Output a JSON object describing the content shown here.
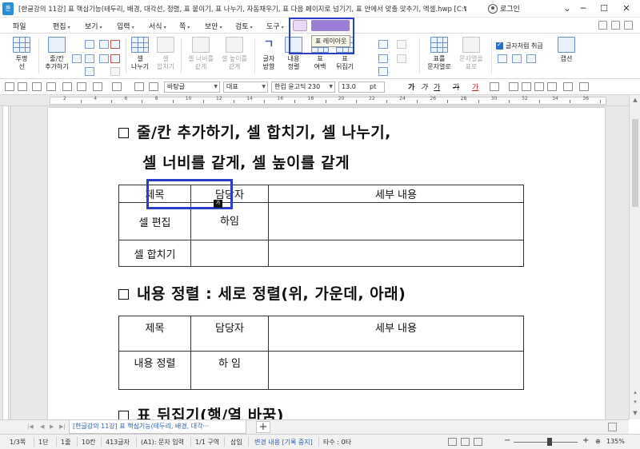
{
  "window": {
    "logo": "훈",
    "title": "[한글강의 11강] 표 핵심기능(테두리, 배경, 대각선, 정렬, 표 붙이기, 표 나누기, 자동채우기, 표 다음 페이지로 넘기기, 표 안에서 맞출 맞추기, 엑셀.hwp [C:₩Users₩user···",
    "login_label": "로그인",
    "minimize": "─",
    "maximize": "☐",
    "close": "✕"
  },
  "menubar": {
    "items": [
      "파일",
      "편집",
      "보기",
      "입력",
      "서식",
      "쪽",
      "보안",
      "검토",
      "도구"
    ],
    "tooltip": "표 레이아웃",
    "search_placeholder": "찾을 내용"
  },
  "ribbon": {
    "transparent_line": "투명\n선",
    "add_row_col": "줄/칸\n추가하기",
    "merge_cells": "셀\n나누기",
    "merge_cells_dis": "셀\n합치기",
    "equal_width": "셀 너비를\n같게",
    "equal_height": "셀 높이를\n같게",
    "text_direction": "글자\n방향",
    "content_align": "내용\n정렬",
    "table_margin": "표\n여백",
    "table_flip": "표\n뒤집기",
    "table_to_text": "표를\n문자열로",
    "text_to_table": "문자열을\n표로",
    "keep_text_check": "글자처럼 취급",
    "caption": "캡션"
  },
  "formatbar": {
    "style": "바탕글",
    "lang": "대표",
    "font": "한컴 윤고딕 230",
    "size": "13.0",
    "unit": "pt",
    "bold": "가",
    "italic": "가",
    "underline": "가",
    "strike": "가",
    "color": "가"
  },
  "ruler": {
    "numbers": [
      "2",
      "4",
      "6",
      "8",
      "10",
      "12",
      "14",
      "16",
      "18",
      "20",
      "22",
      "24",
      "26",
      "28",
      "30",
      "32",
      "34",
      "36"
    ]
  },
  "document": {
    "heading1_line1": "줄/칸 추가하기, 셀 합치기, 셀 나누기,",
    "heading1_line2": "셀 너비를 같게, 셀 높이를 같게",
    "table1": {
      "header": [
        "제목",
        "담당자",
        "세부 내용"
      ],
      "rows": [
        [
          "셀 편집",
          "하임",
          ""
        ],
        [
          "셀 합치기",
          "",
          ""
        ]
      ]
    },
    "cell_marker": "가",
    "heading2": "내용 정렬 : 세로 정렬(위, 가운데, 아래)",
    "table2": {
      "header": [
        "제목",
        "담당자",
        "세부 내용"
      ],
      "rows": [
        [
          "내용 정렬",
          "하 임",
          ""
        ]
      ]
    },
    "heading3": "표 뒤집기(행/열 바꿈)"
  },
  "tabbar": {
    "doc_tab": "[한글강의 11강] 표 핵심기능(테두리, 배경, 대각···",
    "add_tab": "+"
  },
  "statusbar": {
    "page": "1/3쪽",
    "section": "1단",
    "line": "1줄",
    "col": "10칸",
    "chars": "413글자",
    "mode": "(A1): 문자 입력",
    "area": "1/1 구역",
    "insert": "삽입",
    "track": "변경 내용 [기록 중지]",
    "typo": "타수 : 0타",
    "zoom": "135%",
    "zoom_minus": "−",
    "zoom_plus": "+"
  },
  "colors": {
    "highlight": "#2b3ec9",
    "tab_text": "#2b5fb5"
  }
}
